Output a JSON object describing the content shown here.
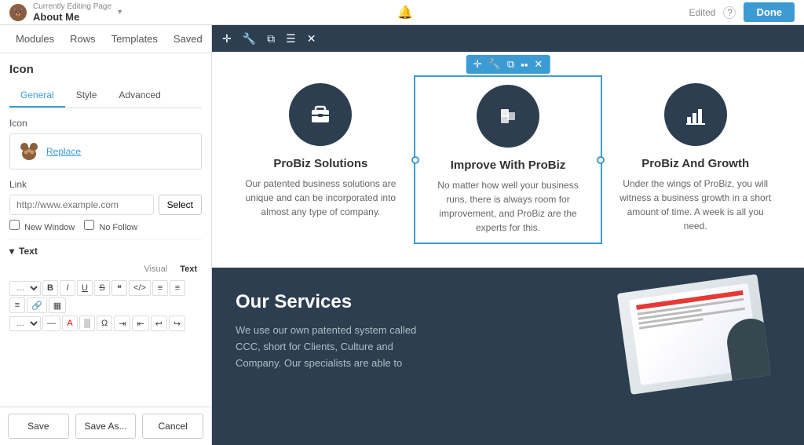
{
  "topbar": {
    "currently_editing": "Currently Editing Page",
    "page_name": "About Me",
    "edited_label": "Edited",
    "done_label": "Done"
  },
  "nav": {
    "tabs": [
      "Modules",
      "Rows",
      "Templates",
      "Saved"
    ]
  },
  "panel": {
    "title": "Icon",
    "sub_tabs": [
      "General",
      "Style",
      "Advanced"
    ],
    "active_sub_tab": "General",
    "icon_label": "Icon",
    "replace_label": "Replace",
    "link_label": "Link",
    "link_placeholder": "http://www.example.com",
    "select_label": "Select",
    "new_window_label": "New Window",
    "no_follow_label": "No Follow",
    "text_section_label": "Text",
    "visual_tab": "Visual",
    "text_tab": "Text"
  },
  "bottom_bar": {
    "save_label": "Save",
    "save_as_label": "Save As...",
    "cancel_label": "Cancel"
  },
  "canvas": {
    "columns": [
      {
        "title": "ProBiz Solutions",
        "description": "Our patented business solutions are unique and can be incorporated into almost any type of company.",
        "icon": "briefcase"
      },
      {
        "title": "Improve With ProBiz",
        "description": "No matter how well your business runs, there is always room for improvement, and ProBiz are the experts for this.",
        "icon": "cubes",
        "selected": true
      },
      {
        "title": "ProBiz And Growth",
        "description": "Under the wings of ProBiz, you will witness a business growth in a short amount of time. A week is all you need.",
        "icon": "chart"
      }
    ],
    "dark_section": {
      "title": "Our Services",
      "description": "We use our own patented system called CCC, short for Clients, Culture and Company. Our specialists are able to"
    }
  },
  "module_toolbar": {
    "icons": [
      "move",
      "wrench",
      "copy",
      "menu",
      "close"
    ]
  }
}
